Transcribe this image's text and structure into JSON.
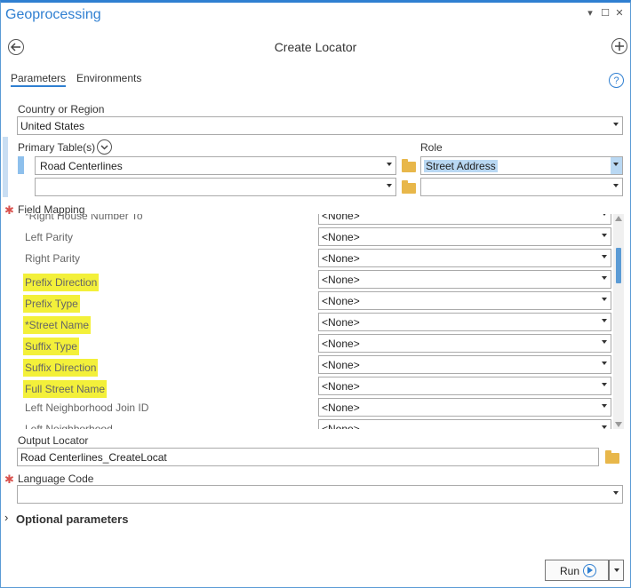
{
  "pane": {
    "title": "Geoprocessing",
    "controls": {
      "pin": "▾",
      "maximize": "☐",
      "close": "✕"
    }
  },
  "tool": {
    "title": "Create Locator",
    "back_icon": "back-arrow-icon",
    "add_icon": "plus-icon"
  },
  "tabs": [
    {
      "label": "Parameters",
      "active": true
    },
    {
      "label": "Environments",
      "active": false
    }
  ],
  "help_glyph": "?",
  "country": {
    "label": "Country or Region",
    "value": "United States"
  },
  "primary_tables": {
    "label": "Primary Table(s)",
    "role_label": "Role",
    "rows": [
      {
        "table": "Road Centerlines",
        "role": "Street Address"
      },
      {
        "table": "",
        "role": ""
      }
    ]
  },
  "field_mapping": {
    "label": "Field Mapping",
    "required": "✱",
    "rows": [
      {
        "name": "*Right House Number To",
        "value": "<None>",
        "highlight": false
      },
      {
        "name": "Left Parity",
        "value": "<None>",
        "highlight": false
      },
      {
        "name": "Right Parity",
        "value": "<None>",
        "highlight": false
      },
      {
        "name": "Prefix Direction",
        "value": "<None>",
        "highlight": true
      },
      {
        "name": "Prefix Type",
        "value": "<None>",
        "highlight": true
      },
      {
        "name": "*Street Name",
        "value": "<None>",
        "highlight": true
      },
      {
        "name": "Suffix Type",
        "value": "<None>",
        "highlight": true
      },
      {
        "name": "Suffix Direction",
        "value": "<None>",
        "highlight": true
      },
      {
        "name": "Full Street Name",
        "value": "<None>",
        "highlight": true
      },
      {
        "name": "Left Neighborhood Join ID",
        "value": "<None>",
        "highlight": false
      },
      {
        "name": "Left Neighborhood",
        "value": "<None>",
        "highlight": false
      }
    ]
  },
  "output_locator": {
    "label": "Output Locator",
    "value": "Road Centerlines_CreateLocat"
  },
  "language_code": {
    "label": "Language Code",
    "required": "✱",
    "value": ""
  },
  "optional": {
    "label": "Optional parameters",
    "chevron": "›"
  },
  "run": {
    "label": "Run"
  },
  "colors": {
    "accent": "#2f7fd1",
    "highlight": "#f3f03a",
    "required": "#d9534f",
    "selection": "#b9d8f3"
  }
}
